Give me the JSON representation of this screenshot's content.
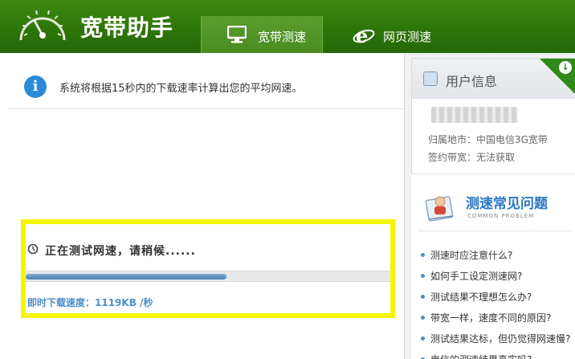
{
  "app": {
    "title": "宽带助手"
  },
  "tabs": [
    {
      "label": "宽带测速",
      "icon": "monitor-icon",
      "active": true
    },
    {
      "label": "网页测速",
      "icon": "ie-browser-icon",
      "active": false
    }
  ],
  "notice": {
    "text": "系统将根据15秒内的下载速率计算出您的平均网速。"
  },
  "test": {
    "status": "正在测试网速，请稍候......",
    "progress": 0.55,
    "speed_label": "即时下载速度：1119KB /秒"
  },
  "user_info": {
    "title": "用户信息",
    "region": "归属地市：中国电信3G宽带",
    "bandwidth": "签约带宽：无法获取"
  },
  "faq": {
    "title": "测速常见问题",
    "subtitle": "COMMON PROBLEM",
    "items": [
      "测速时应注意什么?",
      "如何手工设定测速网?",
      "测试结果不理想怎么办?",
      "带宽一样，速度不同的原因?",
      "测试结果达标，但仍觉得网速慢?",
      "电信的测速结果真实吗?"
    ]
  },
  "colors": {
    "header_green": "#2e7508",
    "accent_blue": "#2a77c4",
    "highlight_yellow": "#f5f500"
  }
}
